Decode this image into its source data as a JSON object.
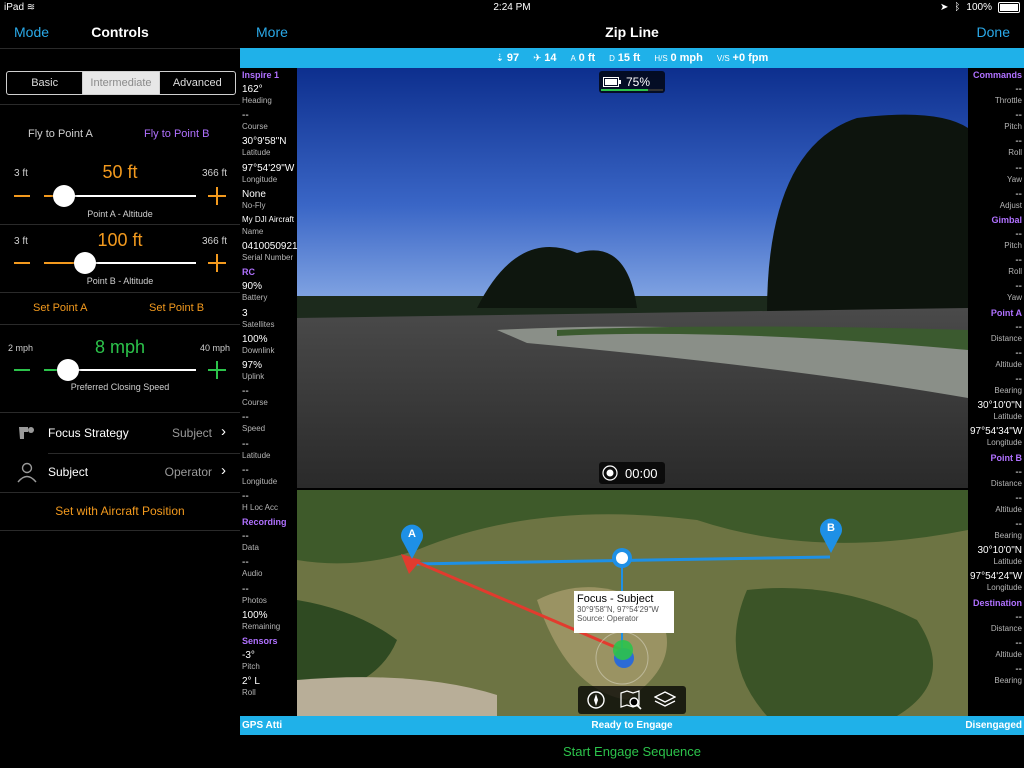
{
  "status_bar": {
    "device": "iPad",
    "time": "2:24 PM",
    "battery": "100%"
  },
  "left_panel": {
    "nav": {
      "mode": "Mode",
      "title": "Controls"
    },
    "tabs": [
      {
        "label": "Basic"
      },
      {
        "label": "Intermediate"
      },
      {
        "label": "Advanced"
      }
    ],
    "fly_to_a": "Fly to Point A",
    "fly_to_b": "Fly to Point B",
    "slider_a": {
      "min": "3 ft",
      "max": "366 ft",
      "value": "50 ft",
      "caption": "Point A - Altitude",
      "fraction": 0.13
    },
    "slider_b": {
      "min": "3 ft",
      "max": "366 ft",
      "value": "100 ft",
      "caption": "Point B - Altitude",
      "fraction": 0.27
    },
    "set_point_a": "Set Point A",
    "set_point_b": "Set Point B",
    "slider_speed": {
      "min": "2 mph",
      "max": "40 mph",
      "value": "8 mph",
      "caption": "Preferred Closing Speed",
      "fraction": 0.16
    },
    "focus_strategy": {
      "label": "Focus Strategy",
      "value": "Subject"
    },
    "subject": {
      "label": "Subject",
      "value": "Operator"
    },
    "set_with_aircraft": "Set with Aircraft Position",
    "colors": {
      "accent": "#2aa9e8",
      "orange": "#f39a1e",
      "purple": "#b071ff",
      "green": "#2cc34b"
    }
  },
  "top_bar": {
    "more": "More",
    "title": "Zip Line",
    "done": "Done"
  },
  "telemetry_bar": {
    "signal": "97",
    "satellites": "14",
    "a_label": "A",
    "a_value": "0 ft",
    "d_label": "D",
    "d_value": "15 ft",
    "hs_label": "H/S",
    "hs_value": "0 mph",
    "vs_label": "V/S",
    "vs_value": "+0 fpm"
  },
  "left_column": [
    {
      "type": "section",
      "text": "Inspire 1"
    },
    {
      "value": "162°",
      "label": "Heading"
    },
    {
      "value": "--",
      "label": "Course"
    },
    {
      "value": "30°9'58\"N",
      "label": "Latitude"
    },
    {
      "value": "97°54'29\"W",
      "label": "Longitude"
    },
    {
      "value": "None",
      "label": "No-Fly"
    },
    {
      "value": "My DJI Aircraft",
      "label": "Name"
    },
    {
      "value": "0410050921",
      "label": "Serial Number"
    },
    {
      "type": "section",
      "text": "RC"
    },
    {
      "value": "90%",
      "label": "Battery"
    },
    {
      "value": "3",
      "label": "Satellites"
    },
    {
      "value": "100%",
      "label": "Downlink"
    },
    {
      "value": "97%",
      "label": "Uplink"
    },
    {
      "value": "--",
      "label": "Course"
    },
    {
      "value": "--",
      "label": "Speed"
    },
    {
      "value": "--",
      "label": "Latitude"
    },
    {
      "value": "--",
      "label": "Longitude"
    },
    {
      "value": "--",
      "label": "H Loc Acc"
    },
    {
      "type": "section",
      "text": "Recording"
    },
    {
      "value": "--",
      "label": "Data"
    },
    {
      "value": "--",
      "label": "Audio"
    },
    {
      "value": "--",
      "label": "Photos"
    },
    {
      "value": "100%",
      "label": "Remaining"
    },
    {
      "type": "section",
      "text": "Sensors"
    },
    {
      "value": "-3°",
      "label": "Pitch"
    },
    {
      "value": "2° L",
      "label": "Roll"
    }
  ],
  "right_column": [
    {
      "type": "section",
      "text": "Commands"
    },
    {
      "value": "--",
      "label": "Throttle"
    },
    {
      "value": "--",
      "label": "Pitch"
    },
    {
      "value": "--",
      "label": "Roll"
    },
    {
      "value": "--",
      "label": "Yaw"
    },
    {
      "value": "--",
      "label": "Adjust"
    },
    {
      "type": "section",
      "text": "Gimbal"
    },
    {
      "value": "--",
      "label": "Pitch"
    },
    {
      "value": "--",
      "label": "Roll"
    },
    {
      "value": "--",
      "label": "Yaw"
    },
    {
      "type": "section",
      "text": "Point A"
    },
    {
      "value": "--",
      "label": "Distance"
    },
    {
      "value": "--",
      "label": "Altitude"
    },
    {
      "value": "--",
      "label": "Bearing"
    },
    {
      "value": "30°10'0\"N",
      "label": "Latitude"
    },
    {
      "value": "97°54'34\"W",
      "label": "Longitude"
    },
    {
      "type": "section",
      "text": "Point B"
    },
    {
      "value": "--",
      "label": "Distance"
    },
    {
      "value": "--",
      "label": "Altitude"
    },
    {
      "value": "--",
      "label": "Bearing"
    },
    {
      "value": "30°10'0\"N",
      "label": "Latitude"
    },
    {
      "value": "97°54'24\"W",
      "label": "Longitude"
    },
    {
      "type": "section",
      "text": "Destination"
    },
    {
      "value": "--",
      "label": "Distance"
    },
    {
      "value": "--",
      "label": "Altitude"
    },
    {
      "value": "--",
      "label": "Bearing"
    }
  ],
  "camera": {
    "battery": "75%",
    "battery_level": 0.75,
    "record_time": "00:00"
  },
  "map": {
    "marker_a": "A",
    "marker_b": "B",
    "callout_title": "Focus - Subject",
    "callout_coords": "30°9'58\"N, 97°54'29\"W",
    "callout_source": "Source: Operator"
  },
  "bottom_bar": {
    "left": "GPS Atti",
    "center": "Ready to Engage",
    "right": "Disengaged"
  },
  "engage": "Start Engage Sequence"
}
